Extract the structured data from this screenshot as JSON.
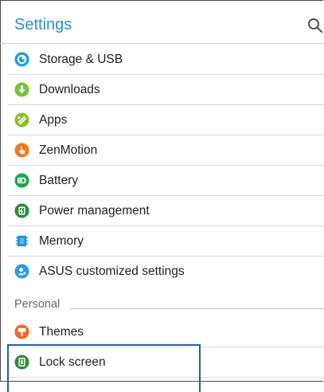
{
  "header": {
    "title": "Settings",
    "search_icon": "search-icon"
  },
  "items": [
    {
      "label": "Storage & USB",
      "icon": "storage-icon",
      "color": "#1aa0d8"
    },
    {
      "label": "Downloads",
      "icon": "download-icon",
      "color": "#7cbf3b"
    },
    {
      "label": "Apps",
      "icon": "apps-icon",
      "color": "#8cbf2e"
    },
    {
      "label": "ZenMotion",
      "icon": "zenmotion-icon",
      "color": "#f07c22"
    },
    {
      "label": "Battery",
      "icon": "battery-icon",
      "color": "#1fa64a"
    },
    {
      "label": "Power management",
      "icon": "power-management-icon",
      "color": "#2f8a3d"
    },
    {
      "label": "Memory",
      "icon": "memory-icon",
      "color": "#1f8fd6"
    },
    {
      "label": "ASUS customized settings",
      "icon": "asus-settings-icon",
      "color": "#2aa0d8"
    }
  ],
  "section": {
    "label": "Personal"
  },
  "personal_items": [
    {
      "label": "Themes",
      "icon": "themes-icon",
      "color": "#f06a1e"
    },
    {
      "label": "Lock screen",
      "icon": "lock-screen-icon",
      "color": "#2f8a3d"
    }
  ]
}
